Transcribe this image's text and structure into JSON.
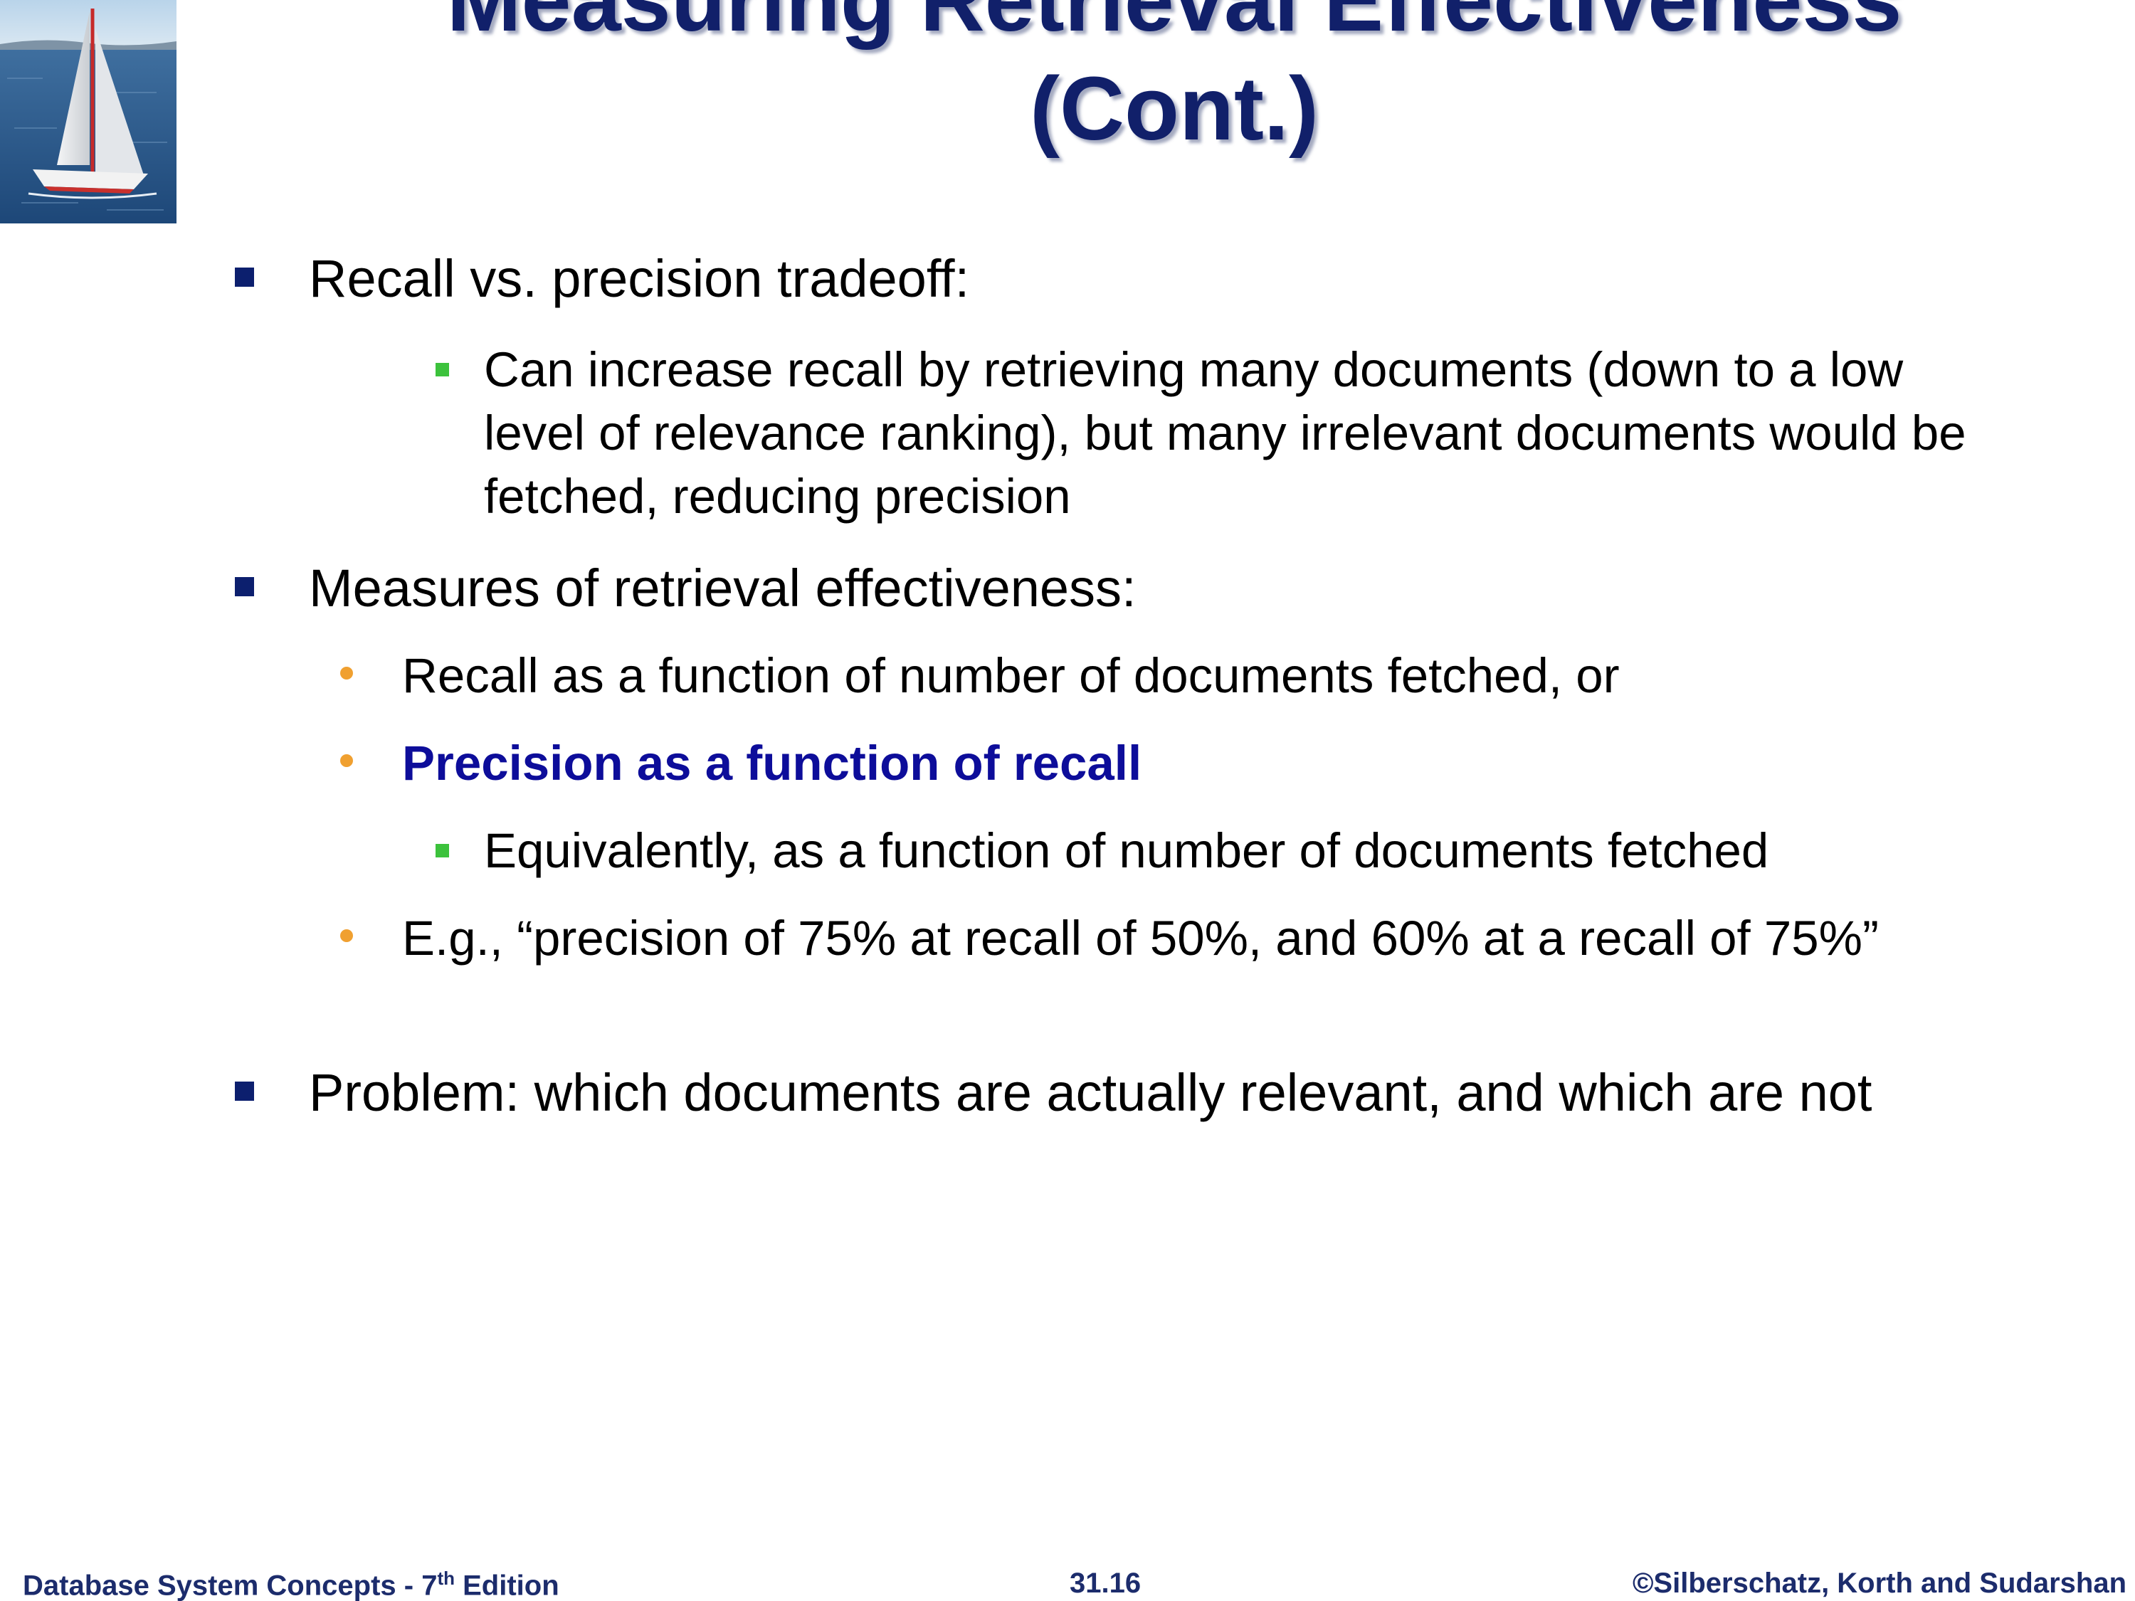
{
  "slide": {
    "title_line1": "Measuring Retrieval Effectiveness",
    "title_line2": "(Cont.)",
    "logo_icon": "sailboat-photo"
  },
  "content": {
    "b1": "Recall vs. precision tradeoff:",
    "b1_sub1": "Can increase recall by retrieving many documents (down to a low level of relevance ranking), but many irrelevant documents would be fetched, reducing precision",
    "b2": "Measures of retrieval effectiveness:",
    "b2_sub1": "Recall as a function of number of documents fetched, or",
    "b2_sub2": "Precision as a function of recall",
    "b2_sub2_sub1": "Equivalently, as a function of number of documents fetched",
    "b2_sub3": "E.g., “precision of 75% at recall of 50%, and 60% at a recall of 75%”",
    "b3": "Problem: which documents are actually relevant, and which are not"
  },
  "footer": {
    "left_main": "Database System Concepts - 7",
    "left_sup": "th",
    "left_tail": " Edition",
    "center": "31.16",
    "right": "©Silberschatz, Korth and Sudarshan"
  },
  "colors": {
    "title": "#11206a",
    "highlight": "#0d0d9a",
    "bullet_level1": "#0c1f6e",
    "bullet_level2": "#f0a030",
    "bullet_level3": "#3cc23c",
    "footer": "#1c2c6c"
  }
}
